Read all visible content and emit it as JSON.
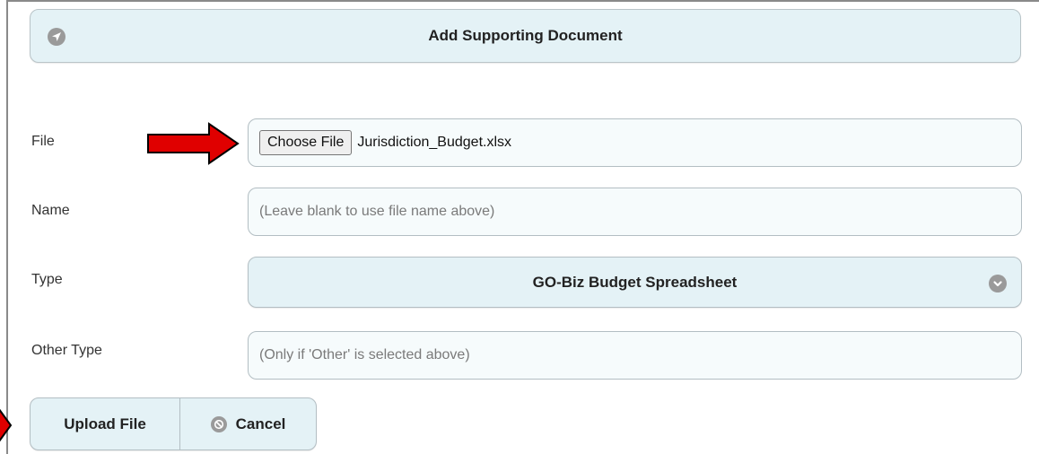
{
  "header": {
    "title": "Add Supporting Document",
    "icon": "navigation-arrow-icon"
  },
  "form": {
    "file": {
      "label": "File",
      "button_label": "Choose File",
      "file_name": "Jurisdiction_Budget.xlsx"
    },
    "name": {
      "label": "Name",
      "value": "",
      "placeholder": "(Leave blank to use file name above)"
    },
    "type": {
      "label": "Type",
      "selected": "GO-Biz Budget Spreadsheet",
      "icon": "chevron-down-icon"
    },
    "other_type": {
      "label": "Other Type",
      "value": "",
      "placeholder": "(Only if 'Other' is selected above)"
    }
  },
  "actions": {
    "upload_label": "Upload File",
    "cancel_label": "Cancel",
    "cancel_icon": "ban-icon"
  },
  "annotations": {
    "arrow_color": "#e00000"
  },
  "colors": {
    "button_bg": "#e4f2f6",
    "input_bg": "#f6fbfc",
    "icon_gray": "#9a9a9a"
  }
}
